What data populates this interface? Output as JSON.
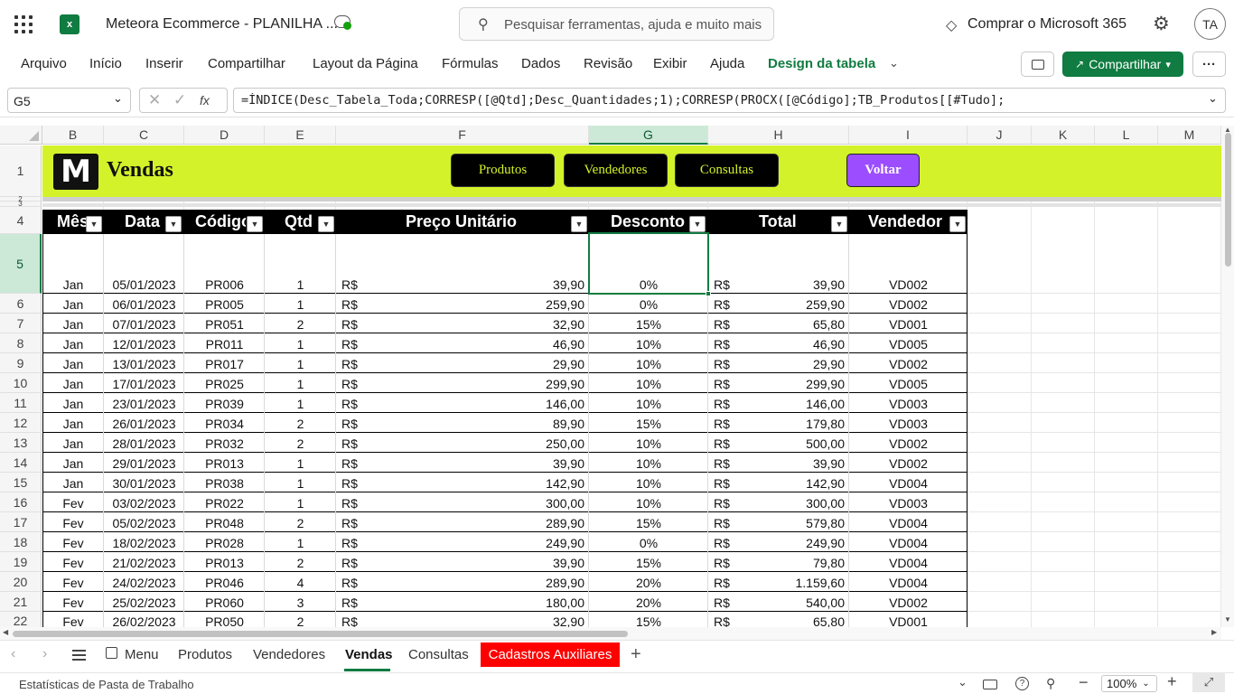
{
  "title_bar": {
    "app_icon": "excel-icon",
    "document_title": "Meteora Ecommerce - PLANILHA ...",
    "search_placeholder": "Pesquisar ferramentas, ajuda e muito mais (Alt + G)",
    "buy_label": "Comprar o Microsoft 365",
    "avatar_initials": "TA"
  },
  "ribbon_tabs": [
    "Arquivo",
    "Início",
    "Inserir",
    "Compartilhar",
    "Layout da Página",
    "Fórmulas",
    "Dados",
    "Revisão",
    "Exibir",
    "Ajuda",
    "Design da tabela"
  ],
  "share_label": "Compartilhar",
  "formula_bar": {
    "name_box": "G5",
    "fx": "fx",
    "formula": "=ÍNDICE(Desc_Tabela_Toda;CORRESP([@Qtd];Desc_Quantidades;1);CORRESP(PROCX([@Código];TB_Produtos[[#Tudo];"
  },
  "columns": [
    "B",
    "C",
    "D",
    "E",
    "F",
    "G",
    "H",
    "I",
    "J",
    "K",
    "L",
    "M"
  ],
  "banner": {
    "logo": "M",
    "title": "Vendas",
    "buttons": [
      "Produtos",
      "Vendedores",
      "Consultas"
    ],
    "back_button": "Voltar",
    "accent": "#d4f229",
    "back_color": "#9b4dff"
  },
  "table_headers": [
    "Mês",
    "Data",
    "Código",
    "Qtd",
    "Preço Unitário",
    "Desconto",
    "Total",
    "Vendedor"
  ],
  "currency": "R$",
  "rows": [
    {
      "row": "5",
      "mes": "Jan",
      "data": "05/01/2023",
      "codigo": "PR006",
      "qtd": "1",
      "preco": "39,90",
      "desconto": "0%",
      "total": "39,90",
      "vendedor": "VD002"
    },
    {
      "row": "6",
      "mes": "Jan",
      "data": "06/01/2023",
      "codigo": "PR005",
      "qtd": "1",
      "preco": "259,90",
      "desconto": "0%",
      "total": "259,90",
      "vendedor": "VD002"
    },
    {
      "row": "7",
      "mes": "Jan",
      "data": "07/01/2023",
      "codigo": "PR051",
      "qtd": "2",
      "preco": "32,90",
      "desconto": "15%",
      "total": "65,80",
      "vendedor": "VD001"
    },
    {
      "row": "8",
      "mes": "Jan",
      "data": "12/01/2023",
      "codigo": "PR011",
      "qtd": "1",
      "preco": "46,90",
      "desconto": "10%",
      "total": "46,90",
      "vendedor": "VD005"
    },
    {
      "row": "9",
      "mes": "Jan",
      "data": "13/01/2023",
      "codigo": "PR017",
      "qtd": "1",
      "preco": "29,90",
      "desconto": "10%",
      "total": "29,90",
      "vendedor": "VD002"
    },
    {
      "row": "10",
      "mes": "Jan",
      "data": "17/01/2023",
      "codigo": "PR025",
      "qtd": "1",
      "preco": "299,90",
      "desconto": "10%",
      "total": "299,90",
      "vendedor": "VD005"
    },
    {
      "row": "11",
      "mes": "Jan",
      "data": "23/01/2023",
      "codigo": "PR039",
      "qtd": "1",
      "preco": "146,00",
      "desconto": "10%",
      "total": "146,00",
      "vendedor": "VD003"
    },
    {
      "row": "12",
      "mes": "Jan",
      "data": "26/01/2023",
      "codigo": "PR034",
      "qtd": "2",
      "preco": "89,90",
      "desconto": "15%",
      "total": "179,80",
      "vendedor": "VD003"
    },
    {
      "row": "13",
      "mes": "Jan",
      "data": "28/01/2023",
      "codigo": "PR032",
      "qtd": "2",
      "preco": "250,00",
      "desconto": "10%",
      "total": "500,00",
      "vendedor": "VD002"
    },
    {
      "row": "14",
      "mes": "Jan",
      "data": "29/01/2023",
      "codigo": "PR013",
      "qtd": "1",
      "preco": "39,90",
      "desconto": "10%",
      "total": "39,90",
      "vendedor": "VD002"
    },
    {
      "row": "15",
      "mes": "Jan",
      "data": "30/01/2023",
      "codigo": "PR038",
      "qtd": "1",
      "preco": "142,90",
      "desconto": "10%",
      "total": "142,90",
      "vendedor": "VD004"
    },
    {
      "row": "16",
      "mes": "Fev",
      "data": "03/02/2023",
      "codigo": "PR022",
      "qtd": "1",
      "preco": "300,00",
      "desconto": "10%",
      "total": "300,00",
      "vendedor": "VD003"
    },
    {
      "row": "17",
      "mes": "Fev",
      "data": "05/02/2023",
      "codigo": "PR048",
      "qtd": "2",
      "preco": "289,90",
      "desconto": "15%",
      "total": "579,80",
      "vendedor": "VD004"
    },
    {
      "row": "18",
      "mes": "Fev",
      "data": "18/02/2023",
      "codigo": "PR028",
      "qtd": "1",
      "preco": "249,90",
      "desconto": "0%",
      "total": "249,90",
      "vendedor": "VD004"
    },
    {
      "row": "19",
      "mes": "Fev",
      "data": "21/02/2023",
      "codigo": "PR013",
      "qtd": "2",
      "preco": "39,90",
      "desconto": "15%",
      "total": "79,80",
      "vendedor": "VD004"
    },
    {
      "row": "20",
      "mes": "Fev",
      "data": "24/02/2023",
      "codigo": "PR046",
      "qtd": "4",
      "preco": "289,90",
      "desconto": "20%",
      "total": "1.159,60",
      "vendedor": "VD004"
    },
    {
      "row": "21",
      "mes": "Fev",
      "data": "25/02/2023",
      "codigo": "PR060",
      "qtd": "3",
      "preco": "180,00",
      "desconto": "20%",
      "total": "540,00",
      "vendedor": "VD002"
    },
    {
      "row": "22",
      "mes": "Fev",
      "data": "26/02/2023",
      "codigo": "PR050",
      "qtd": "2",
      "preco": "32,90",
      "desconto": "15%",
      "total": "65,80",
      "vendedor": "VD001"
    }
  ],
  "sheet_tabs": [
    {
      "label": "Menu",
      "active": false
    },
    {
      "label": "Produtos",
      "active": false
    },
    {
      "label": "Vendedores",
      "active": false
    },
    {
      "label": "Vendas",
      "active": true
    },
    {
      "label": "Consultas",
      "active": false
    },
    {
      "label": "Cadastros Auxiliares",
      "active": false,
      "color": "#ff0000"
    }
  ],
  "status": {
    "left_text": "Estatísticas de Pasta de Trabalho",
    "zoom": "100%"
  }
}
